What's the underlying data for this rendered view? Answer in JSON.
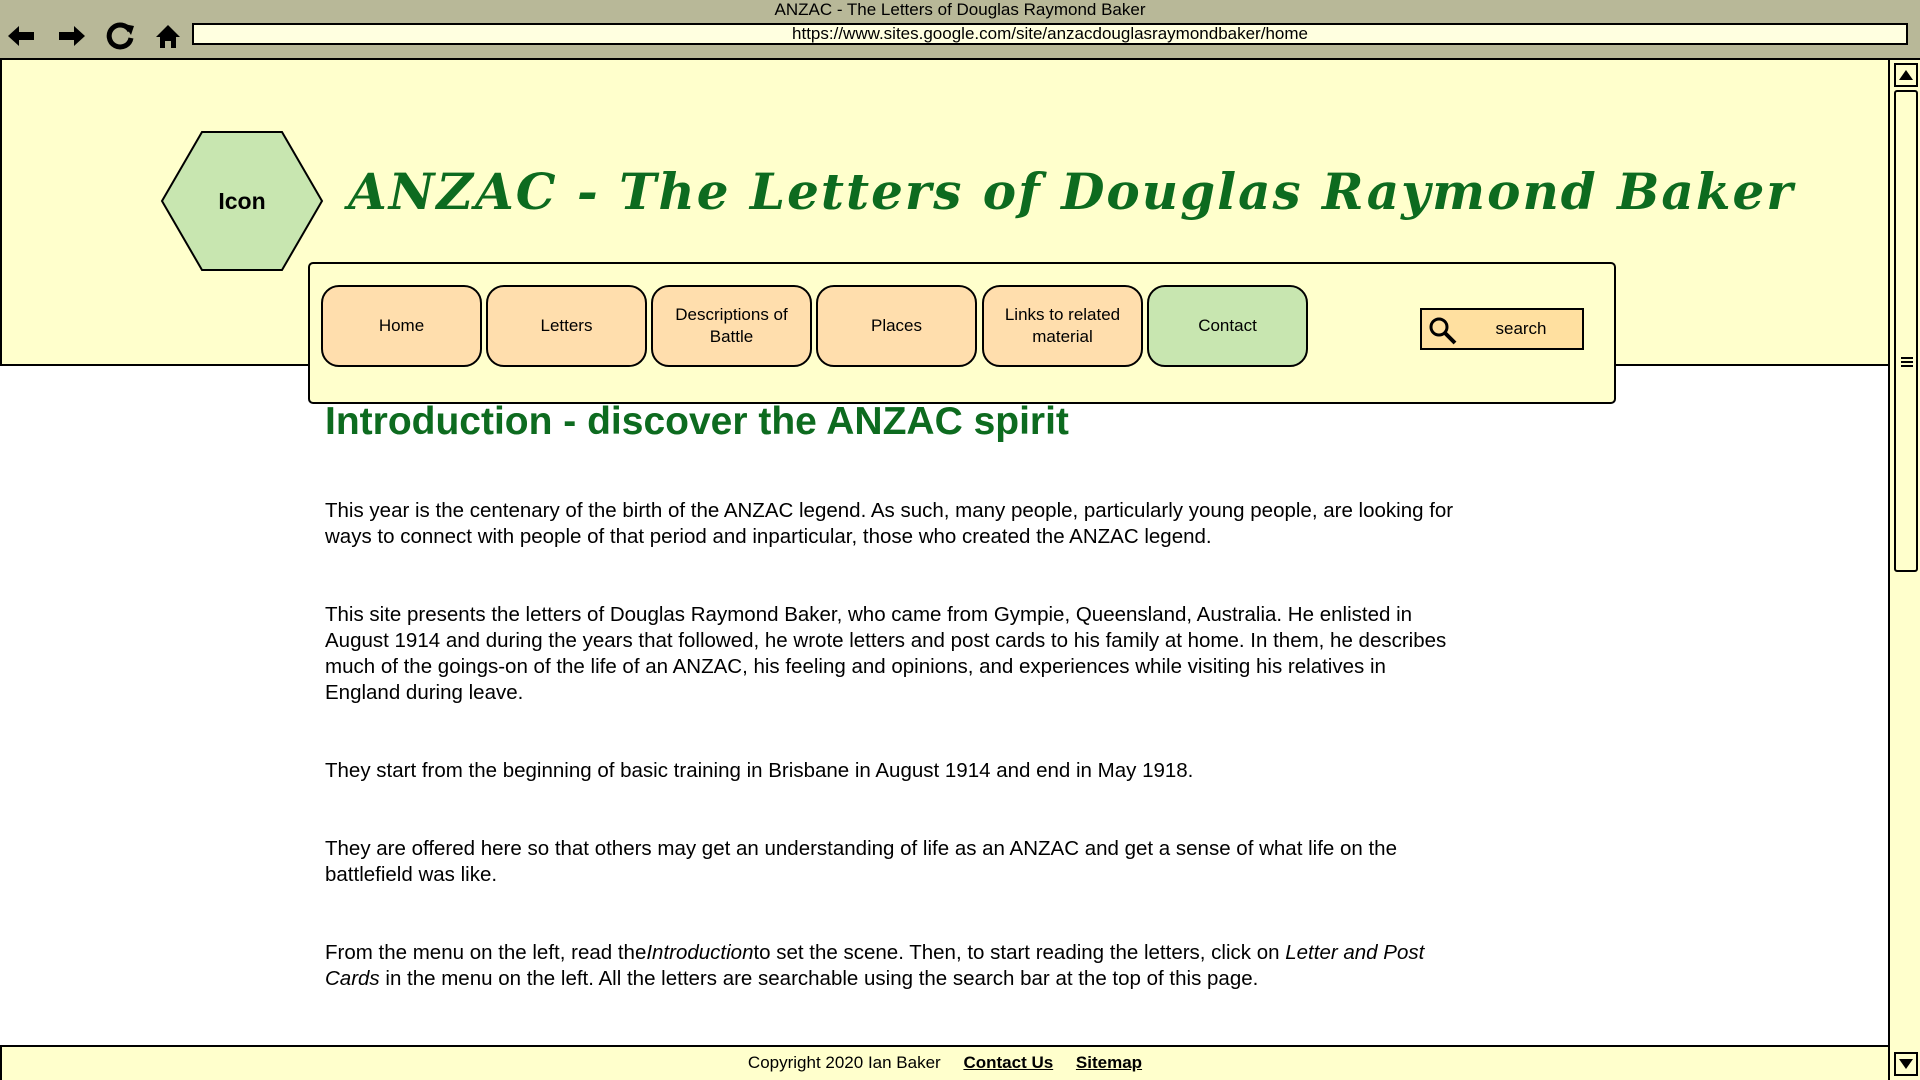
{
  "browser": {
    "window_title": "ANZAC - The Letters of Douglas Raymond Baker",
    "url": "https://www.sites.google.com/site/anzacdouglasraymondbaker/home",
    "icons": [
      "back-arrow-icon",
      "forward-arrow-icon",
      "reload-icon",
      "home-icon"
    ]
  },
  "header": {
    "logo_label": "Icon",
    "site_title": "ANZAC - The Letters of Douglas Raymond Baker",
    "colors": {
      "background": "#ffffcc",
      "title": "#0d6b1f",
      "logo": "#c8e6b0",
      "nav_button": "#ffdead",
      "nav_active": "#c8e6b0",
      "search": "#ffe0a0"
    }
  },
  "nav": {
    "items": [
      {
        "label": "Home"
      },
      {
        "label": "Letters"
      },
      {
        "label": "Descriptions of Battle"
      },
      {
        "label": "Places"
      },
      {
        "label": "Links to related material"
      },
      {
        "label": "Contact",
        "active": true
      }
    ],
    "search": {
      "label": "search",
      "icon": "search-icon"
    }
  },
  "main": {
    "heading": "Introduction - discover the ANZAC spirit",
    "p1": "This year is the centenary of the birth of the ANZAC  legend. As such, many people, particularly young people, are looking  for ways to connect with people of that period and inparticular, those  who created the ANZAC legend.",
    "p2": "This site presents the letters of Douglas Raymond Baker, who came from  Gympie, Queensland, Australia. He enlisted in August 1914 and during the  years that followed, he wrote letters and post cards to his family at  home. In them, he describes much of the goings-on of the life of an  ANZAC, his feeling and opinions, and experiences while visiting his  relatives in England during leave.",
    "p3": "They start from the beginning of basic training in Brisbane in August 1914 and end in May 1918.",
    "p4": "They are offered here  so that others may get an understanding of life as an  ANZAC and get a sense of what life on the battlefield was like.",
    "p5_part1": "From the menu on the left, read the",
    "p5_italic1": "Introduction",
    "p5_part2": "to set the scene. Then, to start reading the letters, click on ",
    "p5_italic2": "Letter and Post Cards",
    "p5_part3": " in the menu on the left. All the letters are searchable using the  search bar at the top of this page."
  },
  "footer": {
    "copyright": "Copyright 2020 Ian Baker",
    "contact_link": "Contact Us",
    "sitemap_link": "Sitemap"
  }
}
